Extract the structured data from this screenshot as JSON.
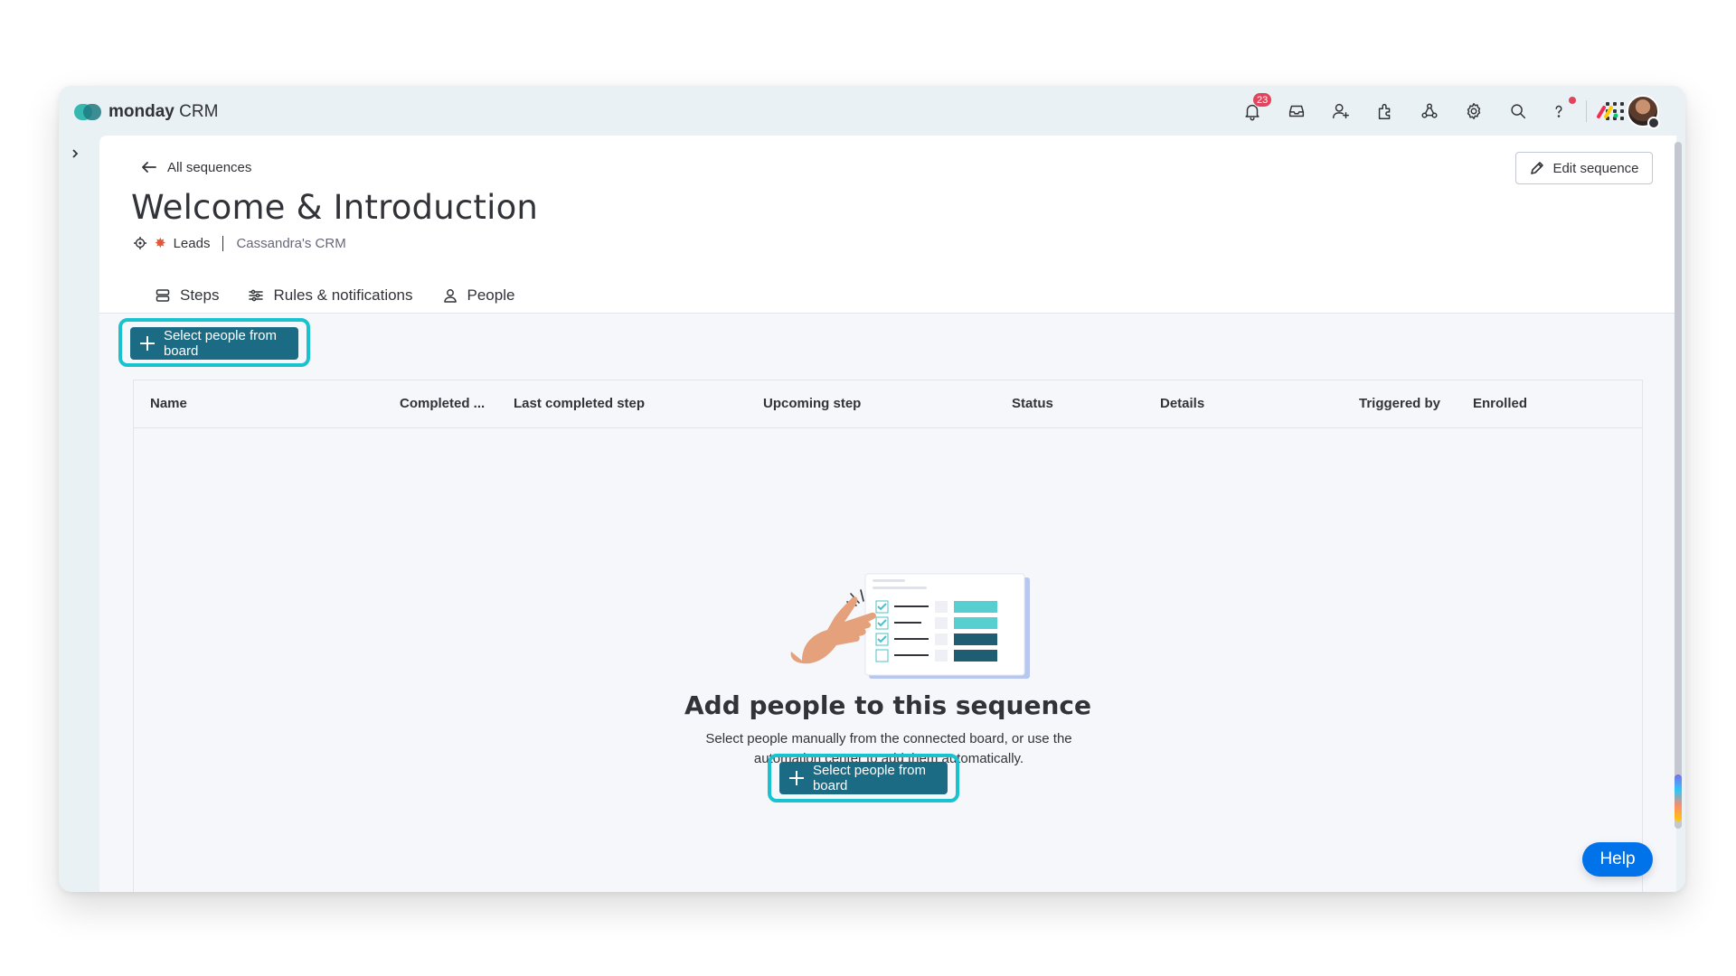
{
  "app": {
    "brand_bold": "monday",
    "brand_light": "CRM",
    "notification_count": "23"
  },
  "top_icons": [
    "bell-icon",
    "inbox-icon",
    "invite-members-icon",
    "apps-icon",
    "integrations-icon",
    "settings-icon",
    "search-icon",
    "help-icon",
    "app-switcher-icon"
  ],
  "nav": {
    "back_label": "All sequences",
    "edit_label": "Edit sequence"
  },
  "page": {
    "title": "Welcome & Introduction",
    "board_name": "Leads",
    "workspace_name": "Cassandra's CRM"
  },
  "tabs": [
    {
      "label": "Steps",
      "icon": "steps-icon",
      "active": false
    },
    {
      "label": "Rules & notifications",
      "icon": "sliders-icon",
      "active": false
    },
    {
      "label": "People",
      "icon": "person-icon",
      "active": true
    }
  ],
  "actions": {
    "select_people_label": "Select people from board"
  },
  "table": {
    "columns": [
      "Name",
      "Completed ...",
      "Last completed step",
      "Upcoming step",
      "Status",
      "Details",
      "Triggered by",
      "Enrolled"
    ]
  },
  "empty_state": {
    "title": "Add people to this sequence",
    "description": "Select people manually from the connected board, or use the automation center to add them automatically.",
    "button_label": "Select people from board"
  },
  "help": {
    "label": "Help"
  },
  "colors": {
    "primary_button": "#1c6b84",
    "highlight_outline": "#18c3cf",
    "help_button": "#0073ea",
    "badge": "#e2445c"
  }
}
